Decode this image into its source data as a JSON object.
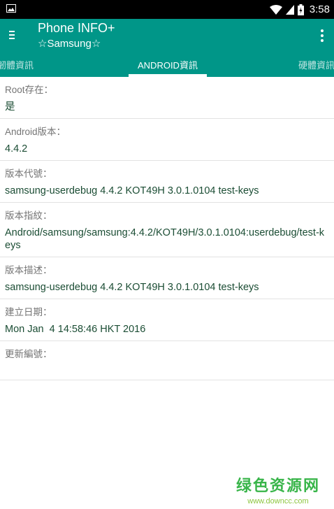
{
  "status_bar": {
    "time": "3:58",
    "icons": [
      "image-notification-icon",
      "wifi-icon",
      "signal-icon",
      "battery-icon"
    ]
  },
  "app_bar": {
    "title": "Phone INFO+",
    "subtitle": "☆Samsung☆"
  },
  "tabs": [
    {
      "label": "韌體資訊",
      "selected": false
    },
    {
      "label": "ANDROID資訊",
      "selected": true
    },
    {
      "label": "硬體資訊",
      "selected": false
    }
  ],
  "rows": [
    {
      "label": "Root存在：",
      "value": "是"
    },
    {
      "label": "Android版本：",
      "value": "4.4.2"
    },
    {
      "label": "版本代號：",
      "value": "samsung-userdebug 4.4.2 KOT49H 3.0.1.0104 test-keys"
    },
    {
      "label": "版本指紋：",
      "value": "Android/samsung/samsung:4.4.2/KOT49H/3.0.1.0104:userdebug/test-keys"
    },
    {
      "label": "版本描述：",
      "value": "samsung-userdebug 4.4.2 KOT49H 3.0.1.0104 test-keys"
    },
    {
      "label": "建立日期：",
      "value": "Mon Jan  4 14:58:46 HKT 2016"
    },
    {
      "label": "更新編號：",
      "value": ""
    }
  ],
  "watermark": {
    "main": "绿色资源网",
    "url": "www.downcc.com"
  },
  "colors": {
    "primary": "#009688",
    "status_bar": "#000000",
    "value_text": "#1b4d34",
    "label_text": "#757575",
    "divider": "#e2e2e2",
    "watermark": "#39b54a"
  }
}
